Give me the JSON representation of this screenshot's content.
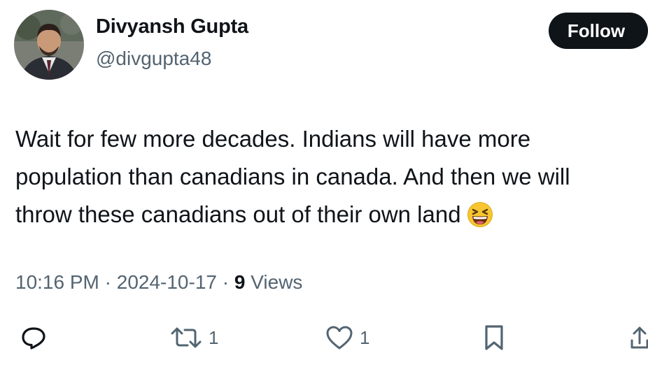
{
  "author": {
    "display_name": "Divyansh Gupta",
    "handle": "@divgupta48"
  },
  "follow_button": {
    "label": "Follow"
  },
  "tweet": {
    "text": "Wait for few more decades. Indians will have more population than canadians in canada. And then we will throw these canadians out of their own land",
    "emoji": "laughing-face-emoji"
  },
  "meta": {
    "time": "10:16 PM",
    "separator": "·",
    "date": "2024-10-17",
    "views_count": "9",
    "views_label": "Views"
  },
  "actions": {
    "reply": {
      "icon": "reply-icon"
    },
    "retweet": {
      "icon": "retweet-icon",
      "count": "1"
    },
    "like": {
      "icon": "heart-icon",
      "count": "1"
    },
    "bookmark": {
      "icon": "bookmark-icon"
    },
    "share": {
      "icon": "share-icon"
    }
  },
  "colors": {
    "text": "#0f1419",
    "secondary": "#536471",
    "button_bg": "#0f1419",
    "button_text": "#ffffff"
  }
}
